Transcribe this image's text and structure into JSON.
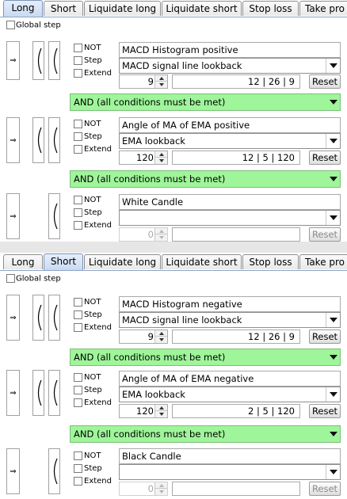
{
  "tabs": [
    "Long",
    "Short",
    "Liquidate long",
    "Liquidate short",
    "Stop loss",
    "Take pro"
  ],
  "global_step_label": "Global step",
  "checkbox_labels": {
    "not": "NOT",
    "step": "Step",
    "extend": "Extend"
  },
  "reset_label": "Reset",
  "arrow_glyph": "⇒",
  "panels": [
    {
      "active_tab": "Long",
      "conditions": [
        {
          "name": "MACD Histogram positive",
          "lookback": "MACD signal line lookback",
          "value": "9",
          "params": "12  |  26  |  9",
          "enabled": true
        },
        {
          "name": "Angle of MA of EMA positive",
          "lookback": "EMA lookback",
          "value": "120",
          "params": "12  |  5  |  120",
          "enabled": true
        },
        {
          "name": "White Candle",
          "lookback": "",
          "value": "0",
          "params": "",
          "enabled": false
        }
      ],
      "and_label": "AND    (all conditions must be met)"
    },
    {
      "active_tab": "Short",
      "conditions": [
        {
          "name": "MACD Histogram negative",
          "lookback": "MACD signal line lookback",
          "value": "9",
          "params": "12  |  26  |  9",
          "enabled": true
        },
        {
          "name": "Angle of MA of EMA negative",
          "lookback": "EMA lookback",
          "value": "120",
          "params": "2  |  5  |  120",
          "enabled": true
        },
        {
          "name": "Black Candle",
          "lookback": "",
          "value": "0",
          "params": "",
          "enabled": false
        }
      ],
      "and_label": "AND    (all conditions must be met)"
    }
  ],
  "colors": {
    "and_bar": "#9ff59a",
    "tab_active": "#c8daf2"
  }
}
